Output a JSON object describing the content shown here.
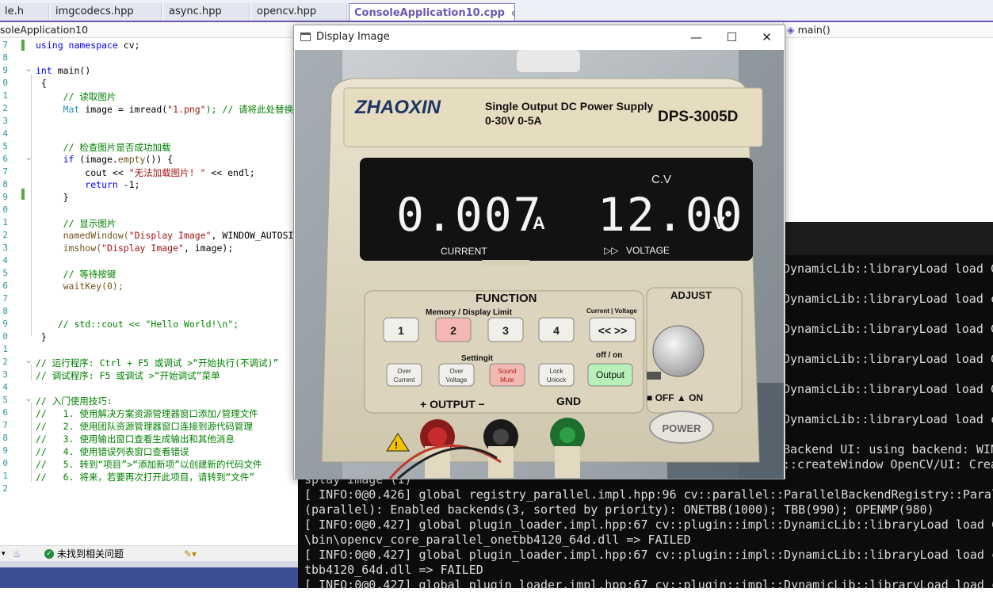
{
  "tabs": [
    {
      "label": "le.h"
    },
    {
      "label": "imgcodecs.hpp"
    },
    {
      "label": "async.hpp"
    },
    {
      "label": "opencv.hpp"
    },
    {
      "label": "ConsoleApplication10.cpp",
      "pin": "⊕",
      "close": "✕"
    }
  ],
  "nav": {
    "project": "soleApplication10",
    "scope": "main()"
  },
  "line_numbers": [
    "7",
    "8",
    "9",
    "0",
    "1",
    "2",
    "3",
    "4",
    "5",
    "6",
    "7",
    "8",
    "9",
    "0",
    "1",
    "2",
    "3",
    "4",
    "5",
    "6",
    "7",
    "8",
    "9",
    "0",
    "1",
    "2",
    "3",
    "4",
    "5",
    "6",
    "7",
    "8",
    "9",
    "0",
    "1",
    "2"
  ],
  "code": {
    "l1_a": "using",
    "l1_b": " namespace",
    "l1_c": " cv;",
    "l3_a": "int",
    "l3_b": " main()",
    "l4": " {",
    "l5": "     // 读取图片",
    "l6_a": "     Mat",
    "l6_b": " image = imread(",
    "l6_c": "\"1.png\"",
    "l6_d": "); // 请将此处替换",
    "l9": "     // 检查图片是否成功加载",
    "l10_a": "     if",
    "l10_b": " (image.",
    "l10_c": "empty",
    "l10_d": "()) {",
    "l11_a": "         cout << ",
    "l11_b": "\"无法加载图片! \"",
    "l11_c": " << endl;",
    "l12_a": "         return",
    "l12_b": " -1;",
    "l13": "     }",
    "l15": "     // 显示图片",
    "l16_a": "     namedWindow(",
    "l16_b": "\"Display Image\"",
    "l16_c": ", WINDOW_AUTOSIZE);",
    "l17_a": "     imshow(",
    "l17_b": "\"Display Image\"",
    "l17_c": ", image);",
    "l19": "     // 等待按键",
    "l20": "     waitKey(0);",
    "l23": "    // std::cout << \"Hello World!\\n\";",
    "l24": " }",
    "l26": "// 运行程序: Ctrl + F5 或调试 >“开始执行(不调试)”",
    "l27": "// 调试程序: F5 或调试 >“开始调试”菜单",
    "l29": "// 入门使用技巧:",
    "l30": "//   1. 使用解决方案资源管理器窗口添加/管理文件",
    "l31": "//   2. 使用团队资源管理器窗口连接到源代码管理",
    "l32": "//   3. 使用输出窗口查看生成输出和其他消息",
    "l33": "//   4. 使用错误列表窗口查看错误",
    "l34": "//   5. 转到“项目”>“添加新项”以创建新的代码文件",
    "l35": "//   6. 将来，若要再次打开此项目，请转到“文件”"
  },
  "status": {
    "issues": "未找到相关问题"
  },
  "window": {
    "title": "Display Image",
    "minimize": "—",
    "maximize": "☐",
    "close": "✕"
  },
  "device": {
    "brand": "ZHAOXIN",
    "desc1": "Single Output DC Power Supply",
    "desc2": "0-30V 0-5A",
    "model": "DPS-3005D",
    "mode_label": "C.V",
    "current_value": "0.007",
    "current_unit": "A",
    "voltage_value": "12.00",
    "voltage_unit": "V",
    "current_label": "CURRENT",
    "voltage_arrow": "▷▷",
    "voltage_label": "VOLTAGE",
    "function_label": "FUNCTION",
    "memory_label": "Memory / Display Limit",
    "cv_label": "Current | Voltage",
    "adjust_label": "ADJUST",
    "buttons_row1": [
      "1",
      "2",
      "3",
      "4",
      "<< >>"
    ],
    "setting_label": "Settingit",
    "offon_label": "off / on",
    "buttons_row2": [
      "Over Current",
      "Over Voltage",
      "Sound Mute",
      "Lock Unlock",
      "Output"
    ],
    "output_label": "+  OUTPUT  −",
    "gnd_label": "GND",
    "power_switch": "■ OFF ▲ ON",
    "power_label": "POWER"
  },
  "console": {
    "right_lines": [
      "DynamicLib::libraryLoad load C",
      "DynamicLib::libraryLoad load c",
      "DynamicLib::libraryLoad load C",
      "DynamicLib::libraryLoad load C",
      "DynamicLib::libraryLoad load C",
      "DynamicLib::libraryLoad load c",
      "Backend UI: using backend: WIN",
      "::createWindow OpenCV/UI: Crea"
    ],
    "lines": [
      "splay Image (1)",
      "[ INFO:0@0.426] global registry_parallel.impl.hpp:96 cv::parallel::ParallelBackendRegistry::Paral",
      "(parallel): Enabled backends(3, sorted by priority): ONETBB(1000); TBB(990); OPENMP(980)",
      "[ INFO:0@0.427] global plugin_loader.impl.hpp:67 cv::plugin::impl::DynamicLib::libraryLoad load C",
      "\\bin\\opencv_core_parallel_onetbb4120_64d.dll => FAILED",
      "[ INFO:0@0.427] global plugin_loader.impl.hpp:67 cv::plugin::impl::DynamicLib::libraryLoad load c",
      "tbb4120_64d.dll => FAILED",
      "[ INFO:0@0.427] global plugin_loader.impl.hpp:67 cv::plugin::impl::DynamicLib::libraryLoad load c"
    ]
  }
}
